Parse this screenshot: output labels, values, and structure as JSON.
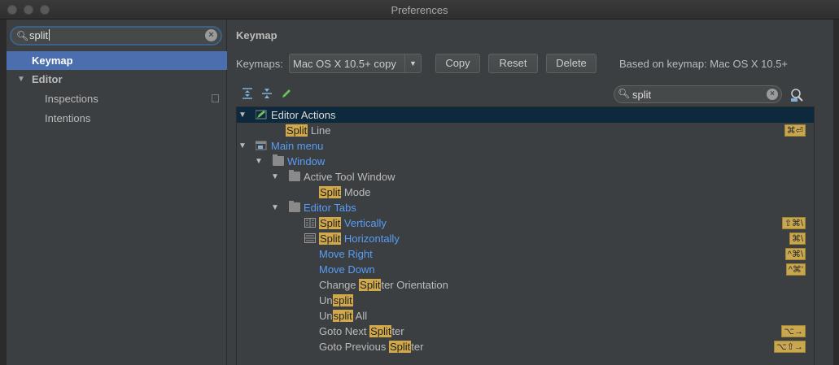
{
  "window": {
    "title": "Preferences"
  },
  "sidebar": {
    "search_value": "split",
    "items": [
      {
        "label": "Keymap",
        "selected": true
      },
      {
        "label": "Editor",
        "expanded": true
      },
      {
        "label": "Inspections"
      },
      {
        "label": "Intentions"
      }
    ]
  },
  "keymap": {
    "title": "Keymap",
    "keymaps_label": "Keymaps:",
    "selected_keymap": "Mac OS X 10.5+ copy",
    "buttons": {
      "copy": "Copy",
      "reset": "Reset",
      "delete": "Delete"
    },
    "based_on": "Based on keymap: Mac OS X 10.5+",
    "filter_value": "split"
  },
  "tree": {
    "rows": [
      {
        "pre": "",
        "hl": "",
        "post": "Editor Actions",
        "color": "white",
        "shortcut": ""
      },
      {
        "pre": "",
        "hl": "Split",
        "post": " Line",
        "color": "normal",
        "shortcut": "⌘⏎"
      },
      {
        "pre": "",
        "hl": "",
        "post": "Main menu",
        "color": "blue",
        "shortcut": ""
      },
      {
        "pre": "",
        "hl": "",
        "post": "Window",
        "color": "blue",
        "shortcut": ""
      },
      {
        "pre": "",
        "hl": "",
        "post": "Active Tool Window",
        "color": "normal",
        "shortcut": ""
      },
      {
        "pre": "",
        "hl": "Split",
        "post": " Mode",
        "color": "normal",
        "shortcut": ""
      },
      {
        "pre": "",
        "hl": "",
        "post": "Editor Tabs",
        "color": "blue",
        "shortcut": ""
      },
      {
        "pre": "",
        "hl": "Split",
        "post": " Vertically",
        "color": "blue",
        "shortcut": "⇧⌘\\"
      },
      {
        "pre": "",
        "hl": "Split",
        "post": " Horizontally",
        "color": "blue",
        "shortcut": "⌘\\"
      },
      {
        "pre": "",
        "hl": "",
        "post": "Move Right",
        "color": "blue",
        "shortcut": "^⌘\\"
      },
      {
        "pre": "",
        "hl": "",
        "post": "Move Down",
        "color": "blue",
        "shortcut": "^⌘'"
      },
      {
        "pre": "Change ",
        "hl": "Split",
        "post": "ter Orientation",
        "color": "normal",
        "shortcut": ""
      },
      {
        "pre": "Un",
        "hl": "split",
        "post": "",
        "color": "normal",
        "shortcut": ""
      },
      {
        "pre": "Un",
        "hl": "split",
        "post": " All",
        "color": "normal",
        "shortcut": ""
      },
      {
        "pre": "Goto Next ",
        "hl": "Split",
        "post": "ter",
        "color": "normal",
        "shortcut": "⌥→"
      },
      {
        "pre": "Goto Previous ",
        "hl": "Split",
        "post": "ter",
        "color": "normal",
        "shortcut": "⌥⇧→"
      }
    ]
  },
  "colors": {
    "selection": "#4b6eaf",
    "tree_selection": "#0d293e",
    "highlight": "#d2a94a",
    "link_blue": "#589df6"
  }
}
